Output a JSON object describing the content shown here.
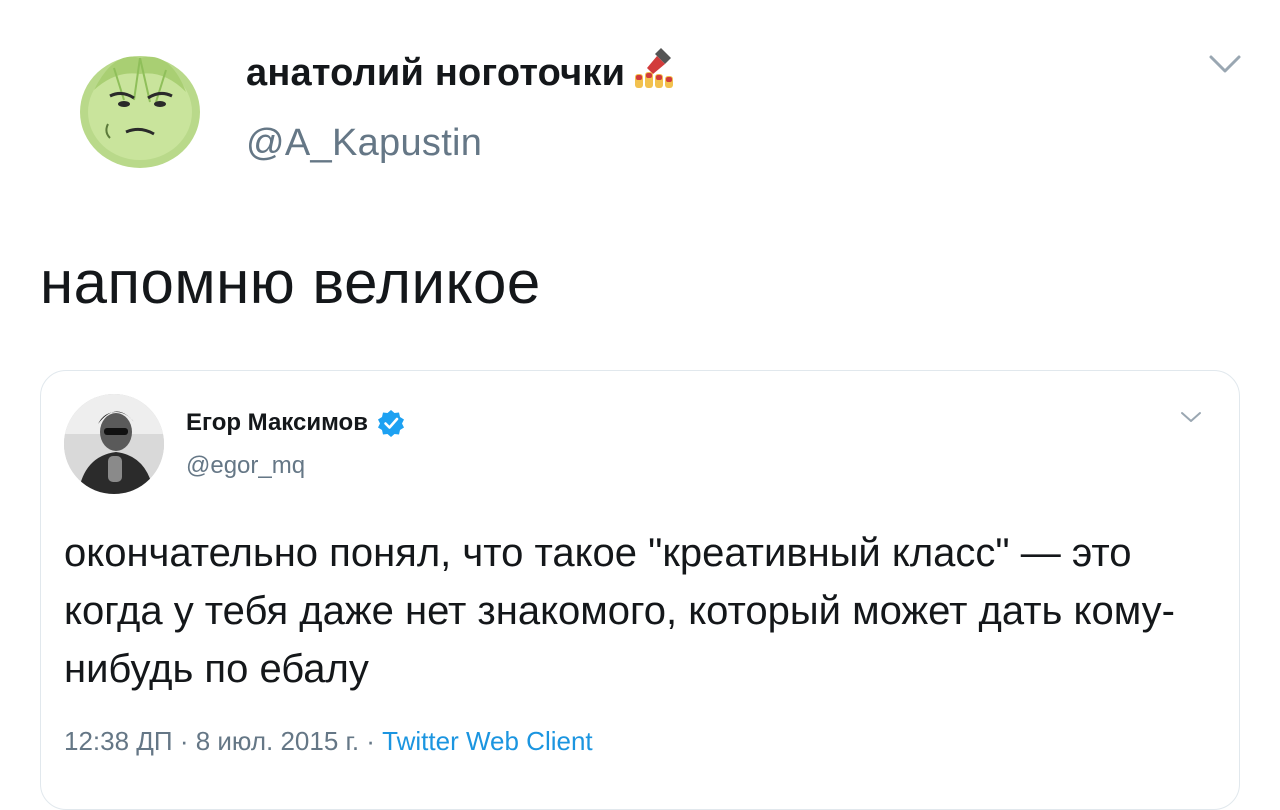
{
  "tweet": {
    "display_name": "анатолий ноготочки",
    "handle": "@A_Kapustin",
    "avatar_icon": "cabbage-avatar",
    "name_emoji_icon": "nail-polish-icon",
    "menu_icon": "chevron-down-icon",
    "text": "напомню великое"
  },
  "quoted": {
    "display_name": "Егор Максимов",
    "verified_icon": "verified-badge-icon",
    "handle": "@egor_mq",
    "menu_icon": "chevron-down-icon",
    "text": "окончательно понял, что такое \"креативный класс\" — это когда у тебя даже нет знакомого, который может дать кому-нибудь по ебалу",
    "time": "12:38 ДП",
    "separator": " · ",
    "date": "8 июл. 2015 г.",
    "source": "Twitter Web Client"
  },
  "colors": {
    "text": "#14171a",
    "muted": "#657786",
    "link": "#1b95e0",
    "verified": "#1da1f2",
    "border": "#e1e8ed"
  }
}
